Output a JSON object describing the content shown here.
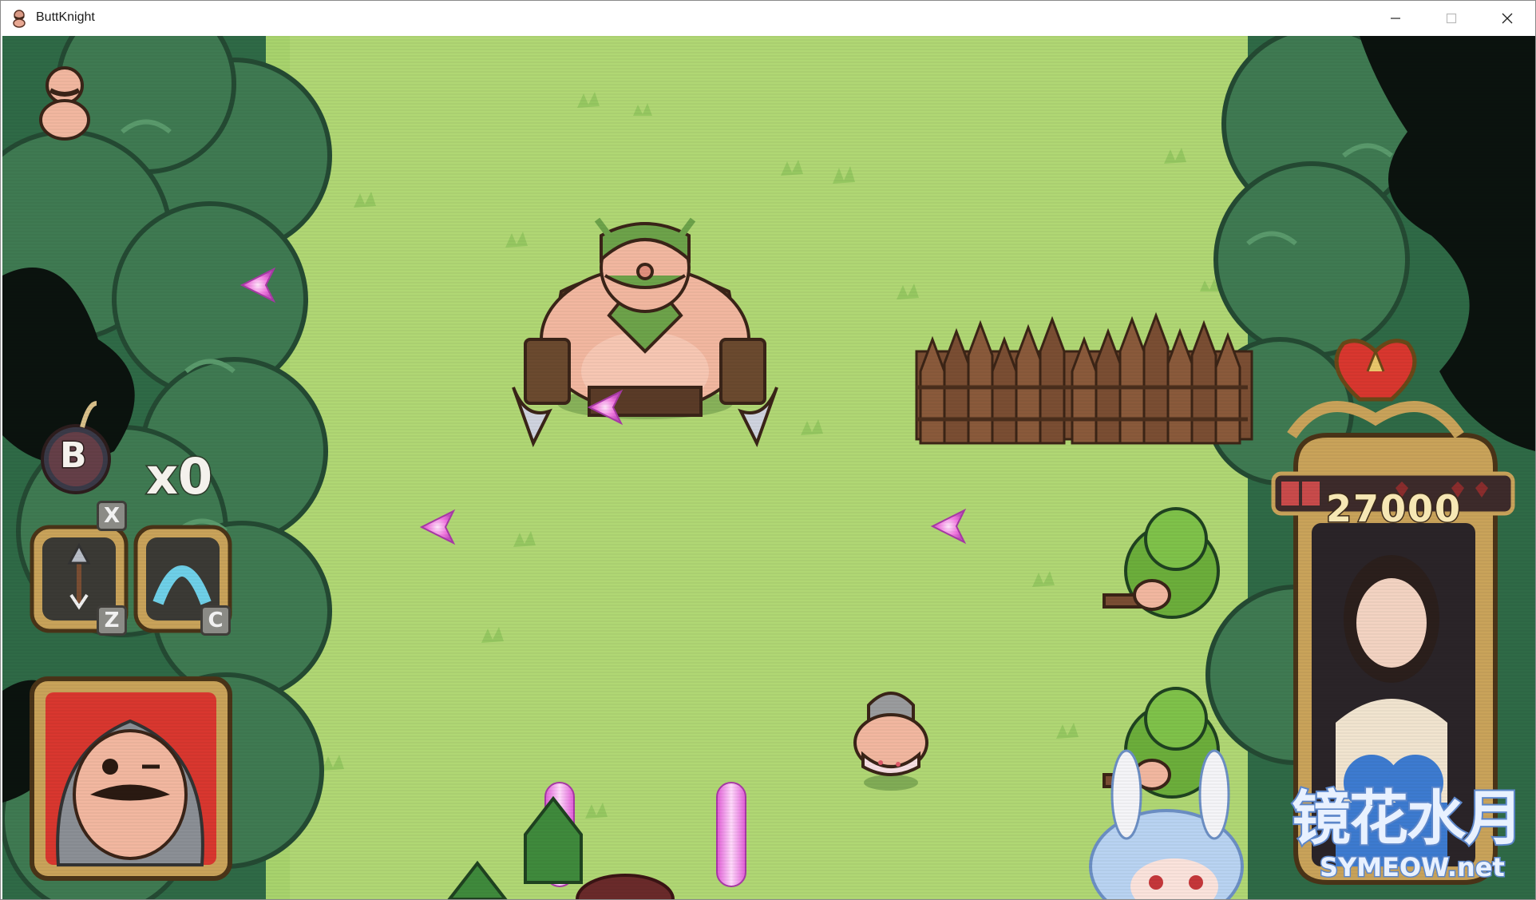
{
  "window": {
    "title": "ButtKnight",
    "controls": [
      "minimize",
      "maximize",
      "close"
    ]
  },
  "hud": {
    "bomb_key": "X",
    "bomb_letter": "B",
    "bomb_count": "x0",
    "skill_1": {
      "icon": "arrow-icon",
      "key": "Z"
    },
    "skill_2": {
      "icon": "shield-arc-icon",
      "key": "C"
    },
    "score": "27000",
    "lives_hearts": 3,
    "player_portrait": "mustached-knight-face"
  },
  "watermark": {
    "title": "镜花水月",
    "subtitle": "SYMEOW.net"
  },
  "colors": {
    "grass": "#a8d36d",
    "tree_dark": "#3f7a52",
    "frame_gold": "#c9a35a",
    "enemy_projectile": "#f27ae0",
    "score_text": "#f6e7b4"
  }
}
